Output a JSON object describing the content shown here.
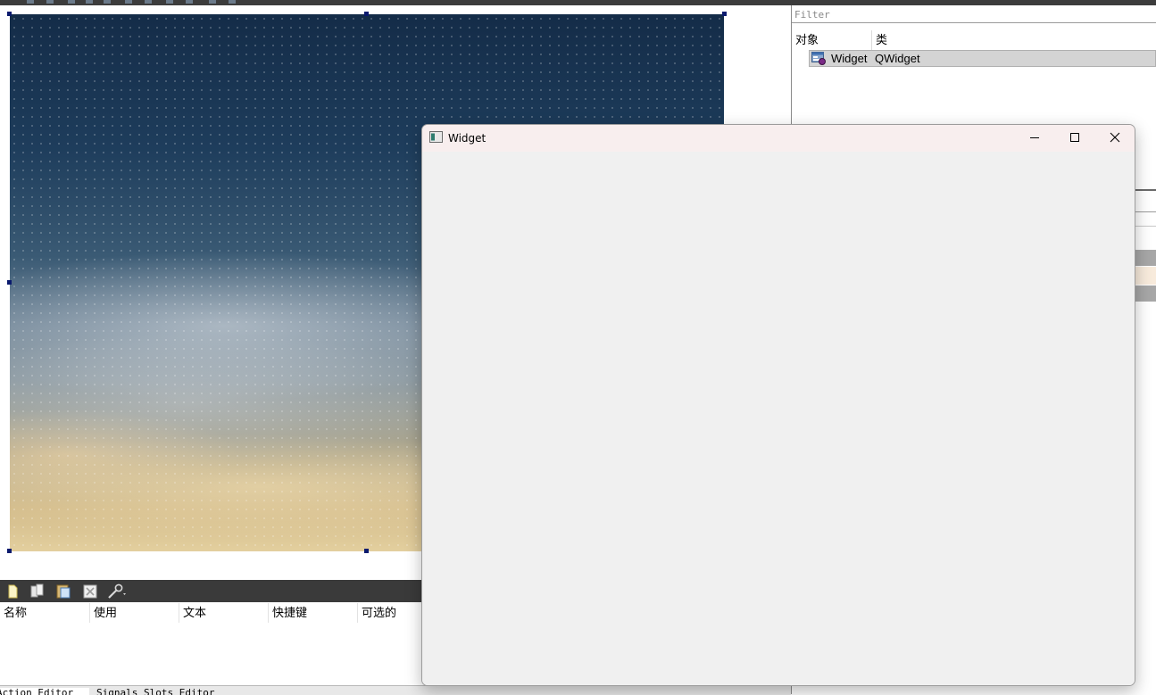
{
  "inspector": {
    "filter_placeholder": "Filter",
    "columns": {
      "object": "对象",
      "class": "类"
    },
    "rows": [
      {
        "name": "Widget",
        "class": "QWidget"
      }
    ]
  },
  "action_editor": {
    "toolbar_icons": [
      "new-action-icon",
      "copy-icon",
      "paste-icon",
      "delete-icon",
      "configure-icon"
    ],
    "columns": [
      "名称",
      "使用",
      "文本",
      "快捷键",
      "可选的"
    ]
  },
  "bottom_tabs": [
    "Action Editor",
    "Signals Slots Editor"
  ],
  "widget_window": {
    "title": "Widget",
    "buttons": [
      "minimize-icon",
      "maximize-icon",
      "close-icon"
    ]
  },
  "colors": {
    "selection_handle": "#0a1a6e",
    "toolbar_bg": "#3a3a3a",
    "titlebar_bg": "#f8eeee",
    "client_bg": "#f0f0f0"
  }
}
